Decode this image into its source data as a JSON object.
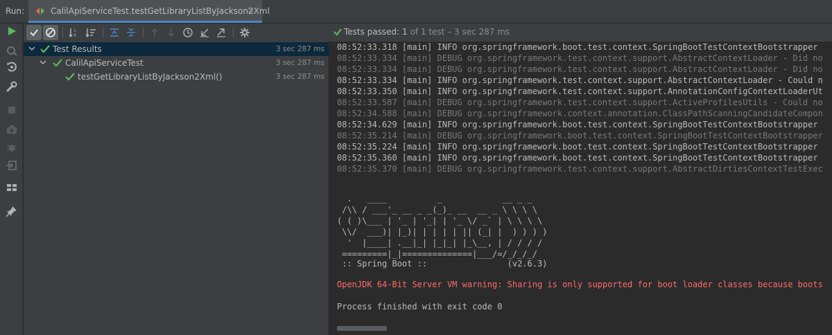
{
  "run_label": "Run:",
  "tab": {
    "title": "CalilApiServiceTest.testGetLibraryListByJackson2Xml",
    "close": "×"
  },
  "status": {
    "passed_label": "Tests passed:",
    "count": "1",
    "detail": "of 1 test – 3 sec 287 ms"
  },
  "tree": {
    "root": {
      "label": "Test Results",
      "time": "3 sec 287 ms"
    },
    "suite": {
      "label": "CalilApiServiceTest",
      "time": "3 sec 287 ms"
    },
    "test": {
      "label": "testGetLibraryListByJackson2Xml()",
      "time": "3 sec 287 ms"
    }
  },
  "console": {
    "log_lines": [
      {
        "level": "info",
        "text": "08:52:33.318 [main] INFO org.springframework.boot.test.context.SpringBootTestContextBootstrapper"
      },
      {
        "level": "debug",
        "text": "08:52:33.334 [main] DEBUG org.springframework.test.context.support.AbstractContextLoader - Did no"
      },
      {
        "level": "debug",
        "text": "08:52:33.334 [main] DEBUG org.springframework.test.context.support.AbstractContextLoader - Did no"
      },
      {
        "level": "info",
        "text": "08:52:33.334 [main] INFO org.springframework.test.context.support.AbstractContextLoader - Could n"
      },
      {
        "level": "info",
        "text": "08:52:33.350 [main] INFO org.springframework.test.context.support.AnnotationConfigContextLoaderUt"
      },
      {
        "level": "debug",
        "text": "08:52:33.587 [main] DEBUG org.springframework.test.context.support.ActiveProfilesUtils - Could no"
      },
      {
        "level": "debug",
        "text": "08:52:34.588 [main] DEBUG org.springframework.context.annotation.ClassPathScanningCandidateCompon"
      },
      {
        "level": "info",
        "text": "08:52:34.629 [main] INFO org.springframework.boot.test.context.SpringBootTestContextBootstrapper"
      },
      {
        "level": "debug",
        "text": "08:52:35.214 [main] DEBUG org.springframework.boot.test.context.SpringBootTestContextBootstrapper"
      },
      {
        "level": "info",
        "text": "08:52:35.224 [main] INFO org.springframework.boot.test.context.SpringBootTestContextBootstrapper"
      },
      {
        "level": "info",
        "text": "08:52:35.360 [main] INFO org.springframework.boot.test.context.SpringBootTestContextBootstrapper"
      },
      {
        "level": "debug",
        "text": "08:52:35.370 [main] DEBUG org.springframework.test.context.support.AbstractDirtiesContextTestExec"
      }
    ],
    "banner": [
      "  .   ____          _            __ _ _",
      " /\\\\ / ___'_ __ _ _(_)_ __  __ _ \\ \\ \\ \\",
      "( ( )\\___ | '_ | '_| | '_ \\/ _` | \\ \\ \\ \\",
      " \\\\/  ___)| |_)| | | | | || (_| |  ) ) ) )",
      "  '  |____| .__|_| |_|_| |_\\__, | / / / /",
      " =========|_|==============|___/=/_/_/_/",
      " :: Spring Boot ::                (v2.6.3)"
    ],
    "warning": "OpenJDK 64-Bit Server VM warning: Sharing is only supported for boot loader classes because boots",
    "finished": "Process finished with exit code 0"
  },
  "colors": {
    "pass_green": "#5fb760",
    "accent_blue": "#4a88c7",
    "selection": "#0d293e",
    "warning_red": "#ff6b68"
  }
}
